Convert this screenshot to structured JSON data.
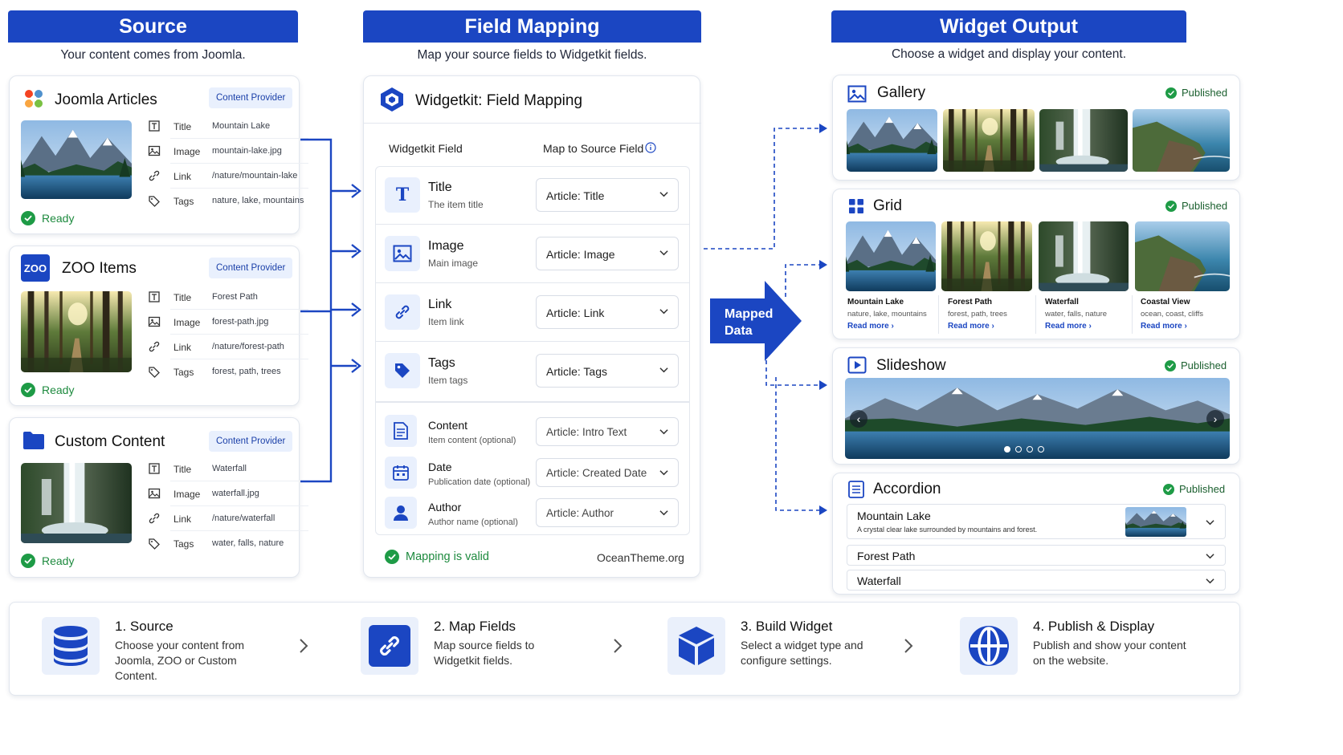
{
  "columns": {
    "source": {
      "title": "Source",
      "subtitle": "Your content comes from Joomla."
    },
    "mapping": {
      "title": "Field Mapping",
      "subtitle": "Map your source fields to Widgetkit fields."
    },
    "output": {
      "title": "Widget Output",
      "subtitle": "Choose a widget and display your content."
    }
  },
  "sources": [
    {
      "title": "Joomla Articles",
      "badge": "Content Provider",
      "icon": "joomla-logo-icon",
      "fields": [
        {
          "label": "Title",
          "value": "Mountain Lake"
        },
        {
          "label": "Image",
          "value": "mountain-lake.jpg"
        },
        {
          "label": "Link",
          "value": "/nature/mountain-lake"
        },
        {
          "label": "Tags",
          "value": "nature, lake, mountains"
        }
      ],
      "status": "Ready"
    },
    {
      "title": "ZOO Items",
      "badge": "Content Provider",
      "icon": "zoo-logo-icon",
      "logo_text": "ZOO",
      "fields": [
        {
          "label": "Title",
          "value": "Forest Path"
        },
        {
          "label": "Image",
          "value": "forest-path.jpg"
        },
        {
          "label": "Link",
          "value": "/nature/forest-path"
        },
        {
          "label": "Tags",
          "value": "forest, path, trees"
        }
      ],
      "status": "Ready"
    },
    {
      "title": "Custom Content",
      "badge": "Content Provider",
      "icon": "folder-icon",
      "fields": [
        {
          "label": "Title",
          "value": "Waterfall"
        },
        {
          "label": "Image",
          "value": "waterfall.jpg"
        },
        {
          "label": "Link",
          "value": "/nature/waterfall"
        },
        {
          "label": "Tags",
          "value": "water, falls, nature"
        }
      ],
      "status": "Ready"
    }
  ],
  "mapping_panel": {
    "title": "Widgetkit: Field Mapping",
    "col_widget": "Widgetkit Field",
    "col_source": "Map to Source Field",
    "primary": [
      {
        "label": "Title",
        "desc": "The item title",
        "value": "Article: Title",
        "icon": "text-icon"
      },
      {
        "label": "Image",
        "desc": "Main image",
        "value": "Article: Image",
        "icon": "image-icon"
      },
      {
        "label": "Link",
        "desc": "Item link",
        "value": "Article: Link",
        "icon": "link-icon"
      },
      {
        "label": "Tags",
        "desc": "Item tags",
        "value": "Article: Tags",
        "icon": "tag-icon"
      }
    ],
    "optional": [
      {
        "label": "Content",
        "desc": "Item content (optional)",
        "value": "Article: Intro Text",
        "icon": "document-icon"
      },
      {
        "label": "Date",
        "desc": "Publication date (optional)",
        "value": "Article: Created Date",
        "icon": "calendar-icon"
      },
      {
        "label": "Author",
        "desc": "Author name (optional)",
        "value": "Article: Author",
        "icon": "user-icon"
      }
    ],
    "status": "Mapping is valid",
    "credit": "OceanTheme.org"
  },
  "mapped_label": "Mapped Data",
  "widgets": {
    "gallery": {
      "title": "Gallery",
      "status": "Published"
    },
    "grid": {
      "title": "Grid",
      "status": "Published",
      "items": [
        {
          "title": "Mountain Lake",
          "tags": "nature, lake, mountains",
          "link": "Read more ›"
        },
        {
          "title": "Forest Path",
          "tags": "forest, path, trees",
          "link": "Read more ›"
        },
        {
          "title": "Waterfall",
          "tags": "water, falls, nature",
          "link": "Read more ›"
        },
        {
          "title": "Coastal View",
          "tags": "ocean, coast, cliffs",
          "link": "Read more ›"
        }
      ]
    },
    "slideshow": {
      "title": "Slideshow",
      "status": "Published"
    },
    "accordion": {
      "title": "Accordion",
      "status": "Published",
      "items": [
        {
          "title": "Mountain Lake",
          "desc": "A crystal clear lake surrounded by mountains and forest."
        },
        {
          "title": "Forest Path"
        },
        {
          "title": "Waterfall"
        }
      ]
    }
  },
  "steps": [
    {
      "title": "1. Source",
      "desc": "Choose your content from Joomla, ZOO or Custom Content.",
      "icon": "database-icon"
    },
    {
      "title": "2. Map Fields",
      "desc": "Map source fields to Widgetkit fields.",
      "icon": "link-icon"
    },
    {
      "title": "3. Build Widget",
      "desc": "Select a widget type and configure settings.",
      "icon": "cube-icon"
    },
    {
      "title": "4. Publish & Display",
      "desc": "Publish and show your content on the website.",
      "icon": "globe-icon"
    }
  ],
  "colors": {
    "primary": "#1b46c2",
    "success": "#1e9b46",
    "light": "#e9f0fd"
  }
}
